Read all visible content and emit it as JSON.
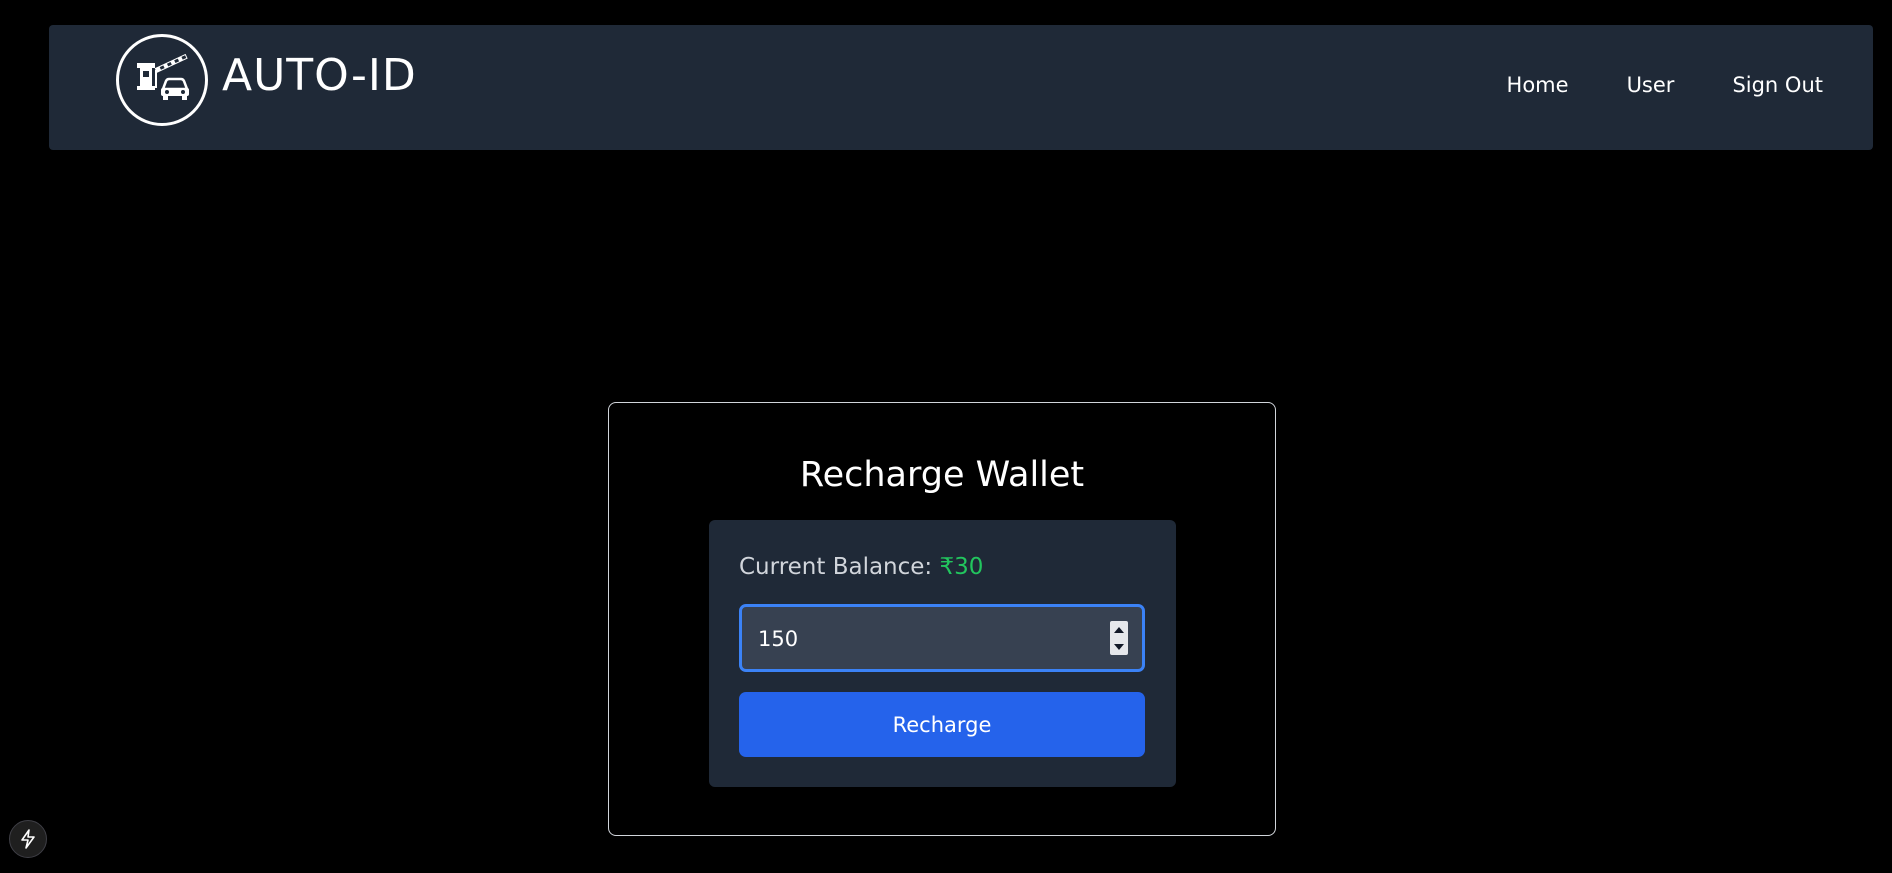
{
  "header": {
    "brand_name": "AUTO-ID",
    "logo_icon": "toll-booth-car-icon",
    "nav": [
      {
        "label": "Home"
      },
      {
        "label": "User"
      },
      {
        "label": "Sign Out"
      }
    ]
  },
  "wallet": {
    "title": "Recharge Wallet",
    "balance_label": "Current Balance:",
    "balance_amount": "₹30",
    "amount_value": "150",
    "recharge_label": "Recharge"
  },
  "colors": {
    "background": "#000000",
    "navbar": "#1f2937",
    "panel": "#1f2937",
    "input": "#374151",
    "input_focus_border": "#3b82f6",
    "button": "#2563eb",
    "balance_amount": "#22c55e"
  },
  "footer": {
    "badge_icon": "lightning-bolt-icon"
  }
}
